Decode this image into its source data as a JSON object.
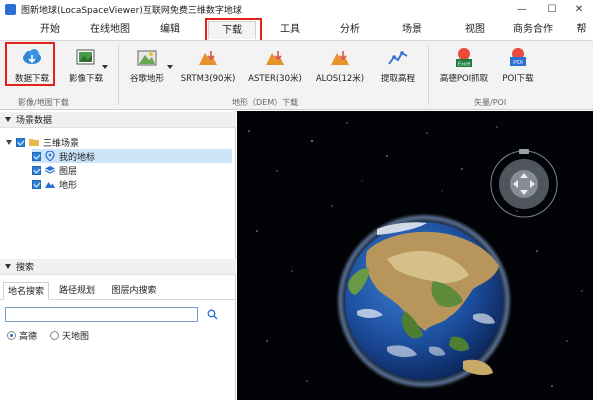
{
  "window": {
    "title": "图新地球(LocaSpaceViewer)互联网免费三维数字地球",
    "minimize_glyph": "—",
    "maximize_glyph": "☐",
    "close_glyph": "✕"
  },
  "menu": {
    "tabs": [
      "开始",
      "在线地图",
      "编辑",
      "下载",
      "工具",
      "分析",
      "场景",
      "视图",
      "商务合作",
      "帮"
    ],
    "active_tab": "下载"
  },
  "ribbon": {
    "groups": [
      {
        "label": "影像/地图下载",
        "buttons": [
          {
            "label": "数据下载",
            "icon": "cloud-download-icon"
          },
          {
            "label": "影像下载",
            "icon": "image-download-icon"
          }
        ]
      },
      {
        "label": "地形（DEM）下载",
        "buttons": [
          {
            "label": "谷歌地形",
            "icon": "google-terrain-icon"
          },
          {
            "label": "SRTM3(90米)",
            "icon": "srtm-icon"
          },
          {
            "label": "ASTER(30米)",
            "icon": "aster-icon"
          },
          {
            "label": "ALOS(12米)",
            "icon": "alos-icon"
          },
          {
            "label": "提取高程",
            "icon": "extract-elevation-icon"
          }
        ]
      },
      {
        "label": "矢量/POI",
        "buttons": [
          {
            "label": "高德POI抓取",
            "icon": "excel-poi-icon",
            "badge": "Excel"
          },
          {
            "label": "POI下载",
            "icon": "poi-download-icon",
            "badge": "POI"
          }
        ]
      }
    ]
  },
  "scene_panel": {
    "header": "场景数据",
    "tree": [
      {
        "label": "三维场景",
        "level": 0,
        "icon": "folder-icon"
      },
      {
        "label": "我的地标",
        "level": 1,
        "icon": "placemark-icon",
        "selected": true
      },
      {
        "label": "图层",
        "level": 1,
        "icon": "layers-icon"
      },
      {
        "label": "地形",
        "level": 1,
        "icon": "terrain-icon"
      }
    ]
  },
  "search_panel": {
    "header": "搜索",
    "tabs": [
      "地名搜索",
      "路径规划",
      "图层内搜索"
    ],
    "active_tab": "地名搜索",
    "input_value": "",
    "sources": [
      {
        "label": "高德",
        "selected": true
      },
      {
        "label": "天地图",
        "selected": false
      }
    ]
  },
  "colors": {
    "accent": "#2b6fd6",
    "highlight_box": "#e2231a",
    "viewport_bg": "#020306",
    "selection": "#cce4f7"
  }
}
